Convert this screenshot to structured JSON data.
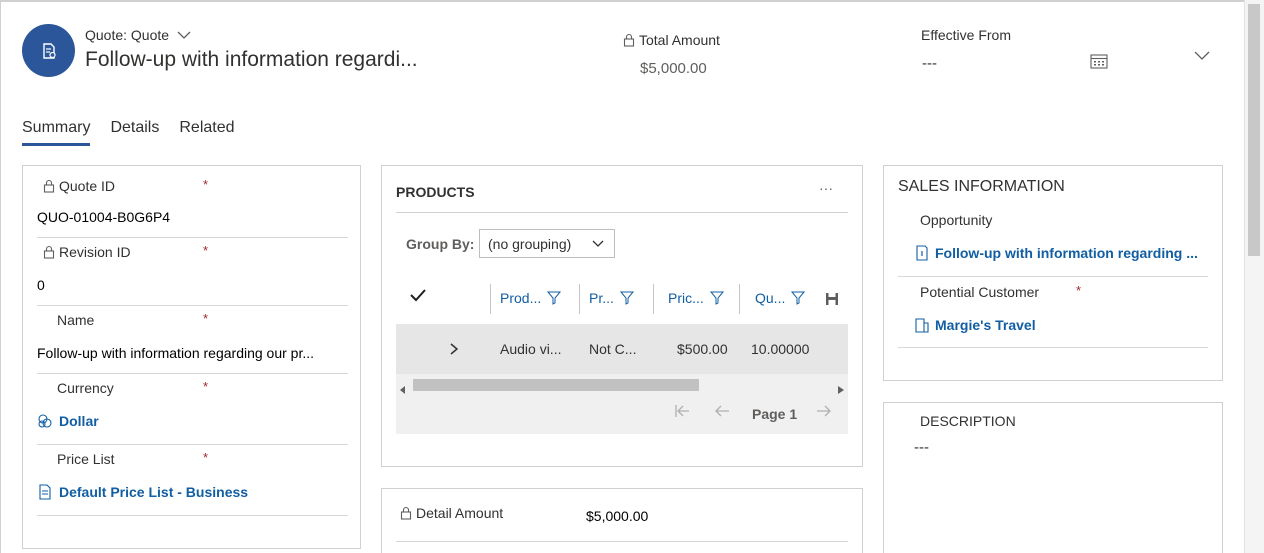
{
  "header": {
    "entity_type": "Quote: Quote",
    "title": "Follow-up with information regardi...",
    "total_amount_label": "Total Amount",
    "total_amount_value": "$5,000.00",
    "effective_from_label": "Effective From",
    "effective_from_value": "---"
  },
  "tabs": [
    {
      "label": "Summary",
      "active": true
    },
    {
      "label": "Details",
      "active": false
    },
    {
      "label": "Related",
      "active": false
    }
  ],
  "general": {
    "quote_id_label": "Quote ID",
    "quote_id_value": "QUO-01004-B0G6P4",
    "revision_id_label": "Revision ID",
    "revision_id_value": "0",
    "name_label": "Name",
    "name_value": "Follow-up with information regarding our pr...",
    "currency_label": "Currency",
    "currency_value": "Dollar",
    "price_list_label": "Price List",
    "price_list_value": "Default Price List - Business",
    "required_marker": "*"
  },
  "products": {
    "title": "PRODUCTS",
    "more": "···",
    "group_by_label": "Group By:",
    "group_by_value": "(no grouping)",
    "columns": [
      "Prod...",
      "Pr...",
      "Pric...",
      "Qu..."
    ],
    "row": [
      "Audio vi...",
      "Not C...",
      "$500.00",
      "10.00000"
    ],
    "page_label": "Page 1"
  },
  "detail": {
    "detail_amount_label": "Detail Amount",
    "detail_amount_value": "$5,000.00"
  },
  "sales": {
    "title": "SALES INFORMATION",
    "opportunity_label": "Opportunity",
    "opportunity_value": "Follow-up with information regarding ...",
    "potential_customer_label": "Potential Customer",
    "potential_customer_value": "Margie's Travel",
    "required_marker": "*"
  },
  "description": {
    "label": "DESCRIPTION",
    "value": "---"
  },
  "colors": {
    "accent": "#2b579a",
    "link": "#115ea3",
    "required": "#a4262c"
  }
}
